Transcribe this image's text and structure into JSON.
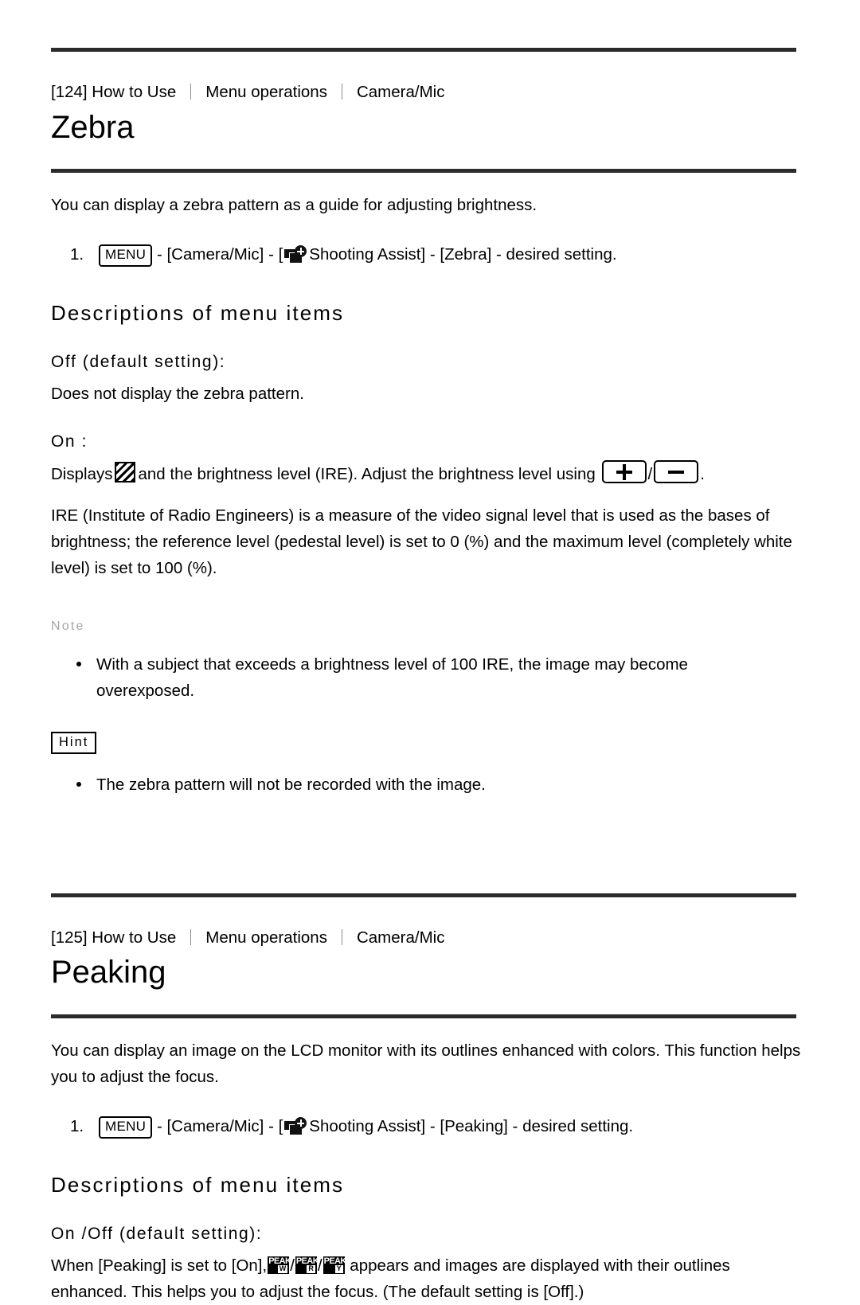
{
  "document": {
    "sections": [
      {
        "id": "zebra",
        "breadcrumb": {
          "page_ref": "[124] How to Use",
          "crumb2": "Menu operations",
          "crumb3": "Camera/Mic"
        },
        "title": "Zebra",
        "intro": "You can display a zebra pattern as a guide for adjusting brightness.",
        "step": {
          "number": "1.",
          "menu_label": "MENU",
          "before_icon": "- [Camera/Mic] - [",
          "icon_name": "shooting-assist-icon",
          "after_icon": "Shooting Assist] - [Zebra] - desired setting."
        },
        "descriptions_heading": "Descriptions of menu items",
        "items": [
          {
            "label": "Off (default setting):",
            "text": "Does not display the zebra pattern."
          },
          {
            "label": "On :",
            "text_part1": "Displays",
            "icon_name": "zebra-pattern-icon",
            "text_part2": "and the brightness level (IRE). Adjust the brightness level using",
            "plus_label": "+",
            "slash": "/",
            "minus_label": "−",
            "text_part3": "."
          }
        ],
        "ire_paragraph": "IRE (Institute of Radio Engineers) is a measure of the video signal level that is used as the bases of brightness; the reference level (pedestal level) is set to 0 (%) and the maximum level (completely white level) is set to 100 (%).",
        "note": {
          "label": "Note",
          "bullets": [
            "With a subject that exceeds a brightness level of 100 IRE, the image may become overexposed."
          ]
        },
        "hint": {
          "label": "Hint",
          "bullets": [
            "The zebra pattern will not be recorded with the image."
          ]
        }
      },
      {
        "id": "peaking",
        "breadcrumb": {
          "page_ref": "[125] How to Use",
          "crumb2": "Menu operations",
          "crumb3": "Camera/Mic"
        },
        "title": "Peaking",
        "intro": "You can display an image on the LCD monitor with its outlines enhanced with colors. This function helps you to adjust the focus.",
        "step": {
          "number": "1.",
          "menu_label": "MENU",
          "before_icon": "- [Camera/Mic] - [",
          "icon_name": "shooting-assist-icon",
          "after_icon": "Shooting Assist] - [Peaking] - desired setting."
        },
        "descriptions_heading": "Descriptions of menu items",
        "items": [
          {
            "label": "On /Off (default setting):",
            "text_part1": "When [Peaking] is set to [On],",
            "icons": [
              {
                "main": "PEAK",
                "badge": "W"
              },
              {
                "main": "PEAK",
                "badge": "R"
              },
              {
                "main": "PEAK",
                "badge": "Y"
              }
            ],
            "separator": "/",
            "text_part2": "appears and images are displayed with their outlines enhanced. This helps you to adjust the focus. (The default setting is [Off].)"
          }
        ]
      }
    ]
  },
  "colors": {
    "rule": "#2b2b2b",
    "text": "#000000",
    "note_label": "#a6a6a6",
    "separator": "#8a8a8a",
    "background": "#ffffff"
  }
}
